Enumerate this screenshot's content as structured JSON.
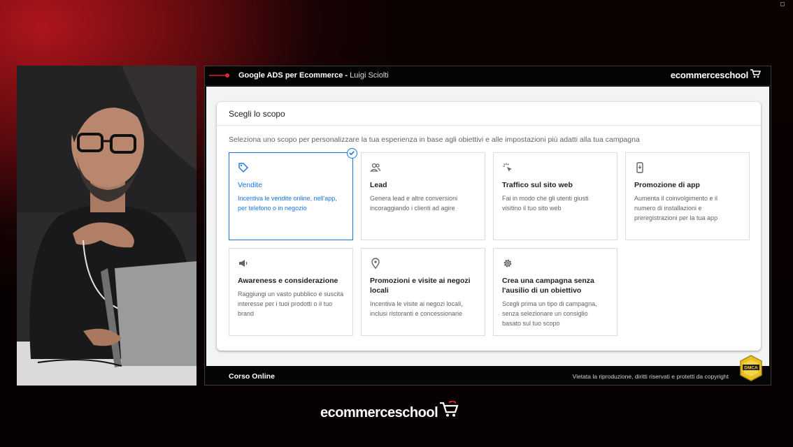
{
  "header": {
    "course_title": "Google ADS per Ecommerce",
    "separator": " - ",
    "author": "Luigi Sciolti",
    "brand": "ecommerceschool"
  },
  "card": {
    "title": "Scegli lo scopo",
    "subtitle": "Seleziona uno scopo per personalizzare la tua esperienza in base agli obiettivi e alle impostazioni più adatti alla tua campagna"
  },
  "options": [
    {
      "icon": "tag-icon",
      "title": "Vendite",
      "desc": "Incentiva le vendite online, nell'app, per telefono o in negozio",
      "selected": true
    },
    {
      "icon": "people-icon",
      "title": "Lead",
      "desc": "Genera lead e altre conversioni incoraggiando i clienti ad agire",
      "selected": false
    },
    {
      "icon": "cursor-click-icon",
      "title": "Traffico sul sito web",
      "desc": "Fai in modo che gli utenti giusti visitino il tuo sito web",
      "selected": false
    },
    {
      "icon": "phone-icon",
      "title": "Promozione di app",
      "desc": "Aumenta il coinvolgimento e il numero di installazioni e preregistrazioni per la tua app",
      "selected": false
    },
    {
      "icon": "megaphone-icon",
      "title": "Awareness e considerazione",
      "desc": "Raggiungi un vasto pubblico e suscita interesse per i tuoi prodotti o il tuo brand",
      "selected": false
    },
    {
      "icon": "location-pin-icon",
      "title": "Promozioni e visite ai negozi locali",
      "desc": "Incentiva le visite ai negozi locali, inclusi ristoranti e concessionarie",
      "selected": false
    },
    {
      "icon": "gear-icon",
      "title": "Crea una campagna senza l'ausilio di un obiettivo",
      "desc": "Scegli prima un tipo di campagna, senza selezionare un consiglio basato sul tuo scopo",
      "selected": false
    }
  ],
  "footer": {
    "label": "Corso Online",
    "rights": "Vietata la riproduzione, diritti riservati e protetti da copyright",
    "badge": "DMCA"
  },
  "brand_bottom": "ecommerceschool",
  "colors": {
    "accent": "#1a73e8",
    "brand_red": "#e3262e"
  }
}
